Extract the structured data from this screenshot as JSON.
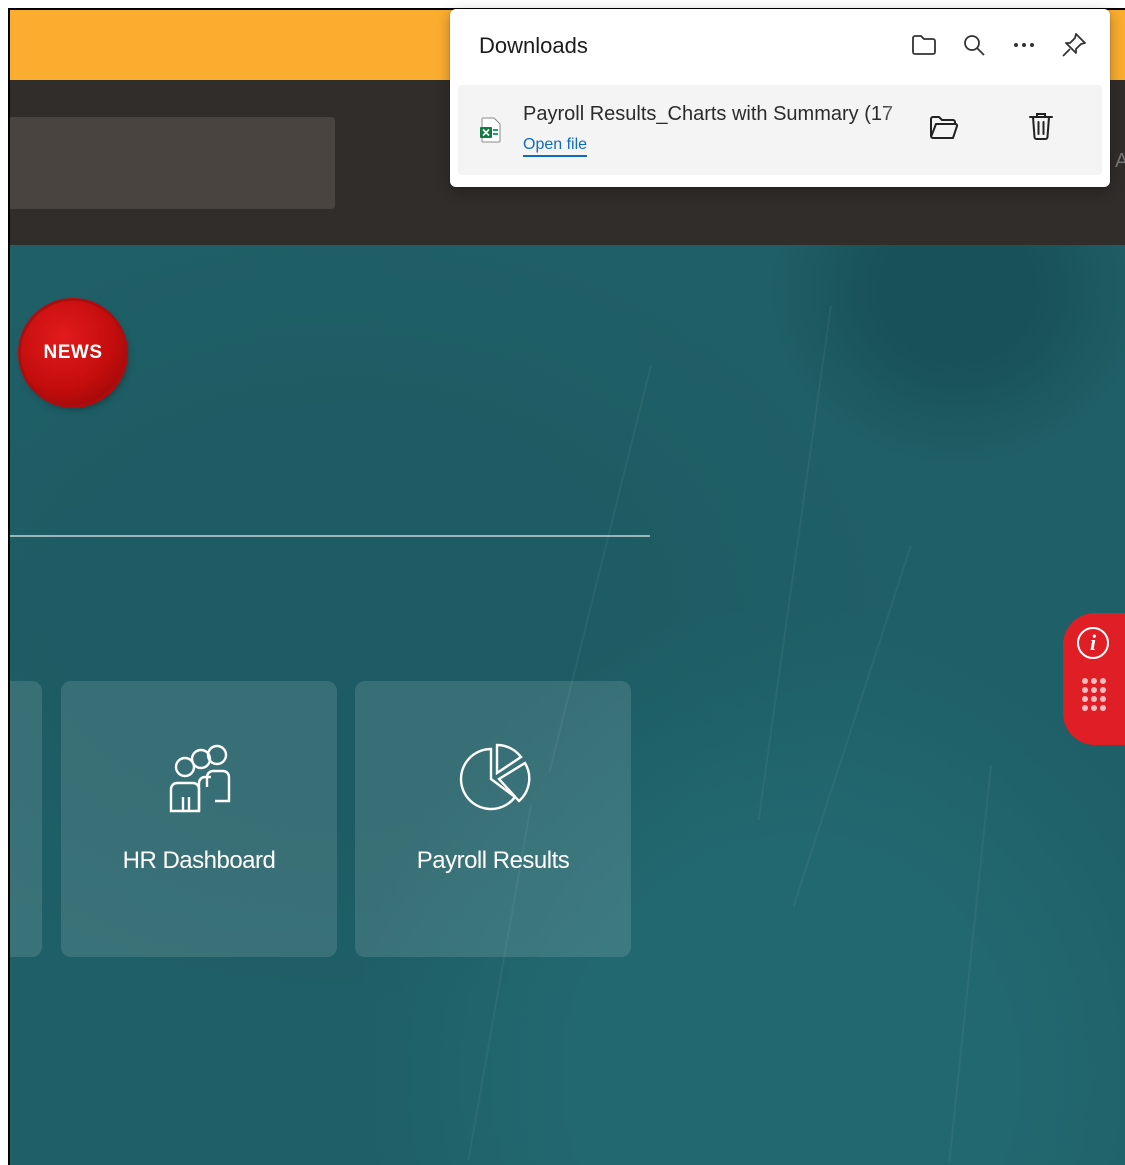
{
  "news_badge": {
    "label": "NEWS"
  },
  "tiles": [
    {
      "label": "HR Dashboard",
      "icon": "people-group-icon"
    },
    {
      "label": "Payroll Results",
      "icon": "pie-chart-icon"
    }
  ],
  "downloads": {
    "title": "Downloads",
    "actions": [
      "open-downloads-folder-icon",
      "search-icon",
      "more-options-icon",
      "pin-icon"
    ],
    "item": {
      "file_name": "Payroll Results_Charts with Summary (17",
      "file_icon": "excel-file-icon",
      "open_link": "Open file"
    }
  },
  "edge_letter": "A",
  "colors": {
    "top_bar": "#fbad2f",
    "header": "#312d2a",
    "background": "#1f5f67",
    "badge_red": "#c40d0d",
    "widget_red": "#e01e26",
    "link_blue": "#0f6cbd"
  }
}
